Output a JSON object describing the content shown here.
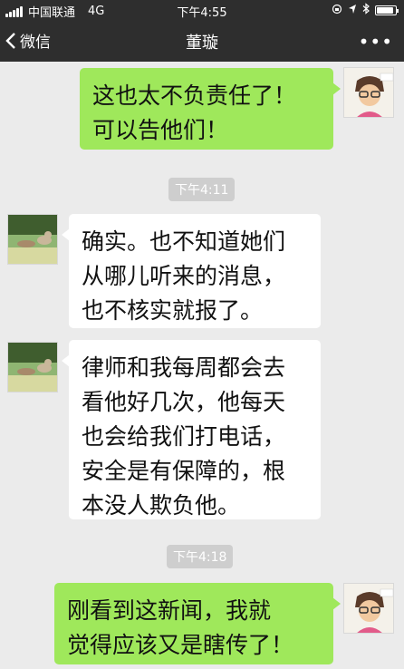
{
  "status_bar": {
    "carrier": "中国联通",
    "network": "4G",
    "time": "下午4:55",
    "icons": [
      "signal-icon",
      "orientation-lock-icon",
      "location-icon",
      "bluetooth-icon",
      "battery-icon"
    ],
    "battery_level": 0.9
  },
  "nav": {
    "back_label": "微信",
    "title": "董璇",
    "more_label": "•••"
  },
  "colors": {
    "sent_bubble": "#9fe85b",
    "received_bubble": "#ffffff",
    "background": "#ebebeb",
    "bar": "#2e2e2e"
  },
  "messages": [
    {
      "direction": "sent",
      "text": "这也太不负责任了！\n可以告他们！"
    },
    {
      "type": "timestamp",
      "text": "下午4:11"
    },
    {
      "direction": "received",
      "text": "确实。也不知道她们\n从哪儿听来的消息，\n也不核实就报了。"
    },
    {
      "direction": "received",
      "text": "律师和我每周都会去\n看他好几次，他每天\n也会给我们打电话，\n安全是有保障的，根\n本没人欺负他。"
    },
    {
      "type": "timestamp",
      "text": "下午4:18"
    },
    {
      "direction": "sent",
      "text": "刚看到这新闻，我就\n觉得应该又是瞎传了！"
    }
  ]
}
